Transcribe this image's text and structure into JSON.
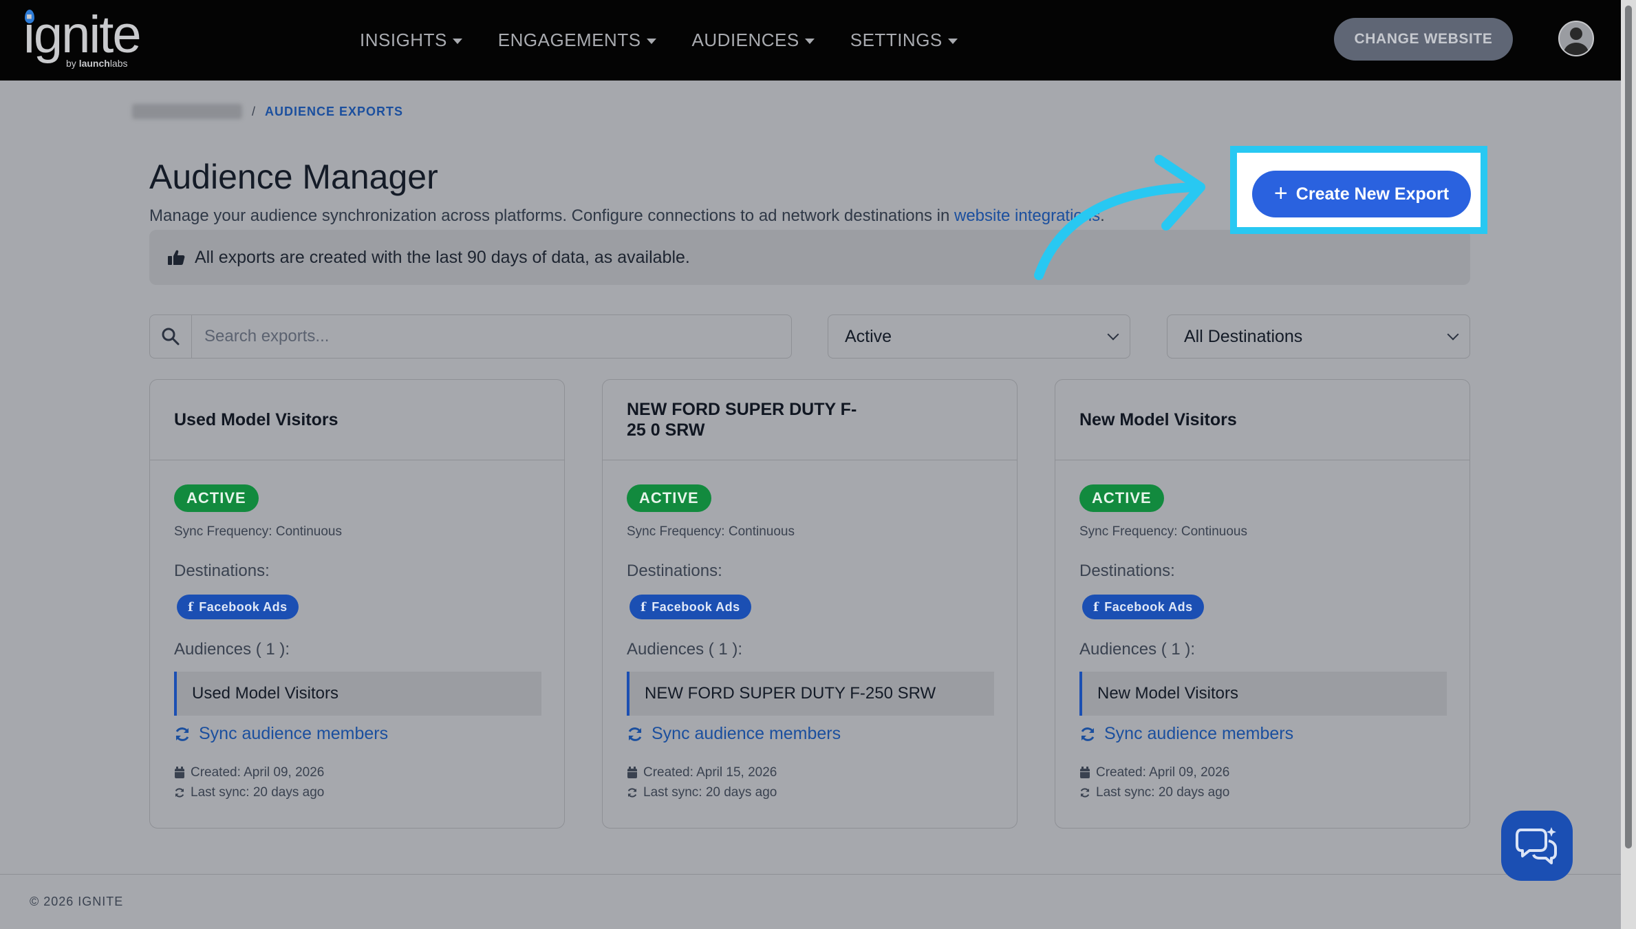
{
  "brand": {
    "logo_word": "ignite",
    "by_prefix": "by ",
    "by_name": "launch",
    "by_suffix": "labs"
  },
  "nav": {
    "items": [
      {
        "label": "INSIGHTS"
      },
      {
        "label": "ENGAGEMENTS"
      },
      {
        "label": "AUDIENCES"
      },
      {
        "label": "SETTINGS"
      }
    ],
    "change_website": "CHANGE WEBSITE"
  },
  "breadcrumb": {
    "separator": "/",
    "current": "AUDIENCE EXPORTS"
  },
  "page": {
    "title": "Audience Manager",
    "subtitle_text": "Manage your audience synchronization across platforms. Configure connections to ad network destinations in ",
    "subtitle_link": "website integrations",
    "subtitle_end": ".",
    "info": "All exports are created with the last 90 days of data, as available.",
    "create_button": "Create New Export",
    "plus": "+"
  },
  "filters": {
    "search_placeholder": "Search exports...",
    "status_selected": "Active",
    "destination_selected": "All Destinations"
  },
  "cards": [
    {
      "title": "Used Model Visitors",
      "status": "ACTIVE",
      "sync_frequency": "Sync Frequency: Continuous",
      "destinations_label": "Destinations:",
      "destination": "Facebook Ads",
      "audiences_label": "Audiences ( 1 ):",
      "audience": "Used Model Visitors",
      "sync_link": "Sync audience members",
      "created": "Created: April 09, 2026",
      "last_sync": "Last sync: 20 days ago"
    },
    {
      "title": "NEW FORD SUPER DUTY F-25 0 SRW",
      "status": "ACTIVE",
      "sync_frequency": "Sync Frequency: Continuous",
      "destinations_label": "Destinations:",
      "destination": "Facebook Ads",
      "audiences_label": "Audiences ( 1 ):",
      "audience": "NEW FORD SUPER DUTY F-250 SRW",
      "sync_link": "Sync audience members",
      "created": "Created: April 15, 2026",
      "last_sync": "Last sync: 20 days ago"
    },
    {
      "title": "New Model Visitors",
      "status": "ACTIVE",
      "sync_frequency": "Sync Frequency: Continuous",
      "destinations_label": "Destinations:",
      "destination": "Facebook Ads",
      "audiences_label": "Audiences ( 1 ):",
      "audience": "New Model Visitors",
      "sync_link": "Sync audience members",
      "created": "Created: April 09, 2026",
      "last_sync": "Last sync: 20 days ago"
    }
  ],
  "footer": {
    "copyright": "© 2026 IGNITE"
  },
  "icons": {
    "facebook_glyph": "f",
    "info": "thumbs-up-icon",
    "search": "search-icon",
    "sync": "sync-icon",
    "calendar": "calendar-icon",
    "chat": "chat-icon",
    "avatar": "user-avatar-icon"
  },
  "colors": {
    "highlight": "#28c8f2",
    "primary": "#2a62df",
    "active_badge": "#128a3e",
    "facebook_pill": "#1b4fb3"
  }
}
